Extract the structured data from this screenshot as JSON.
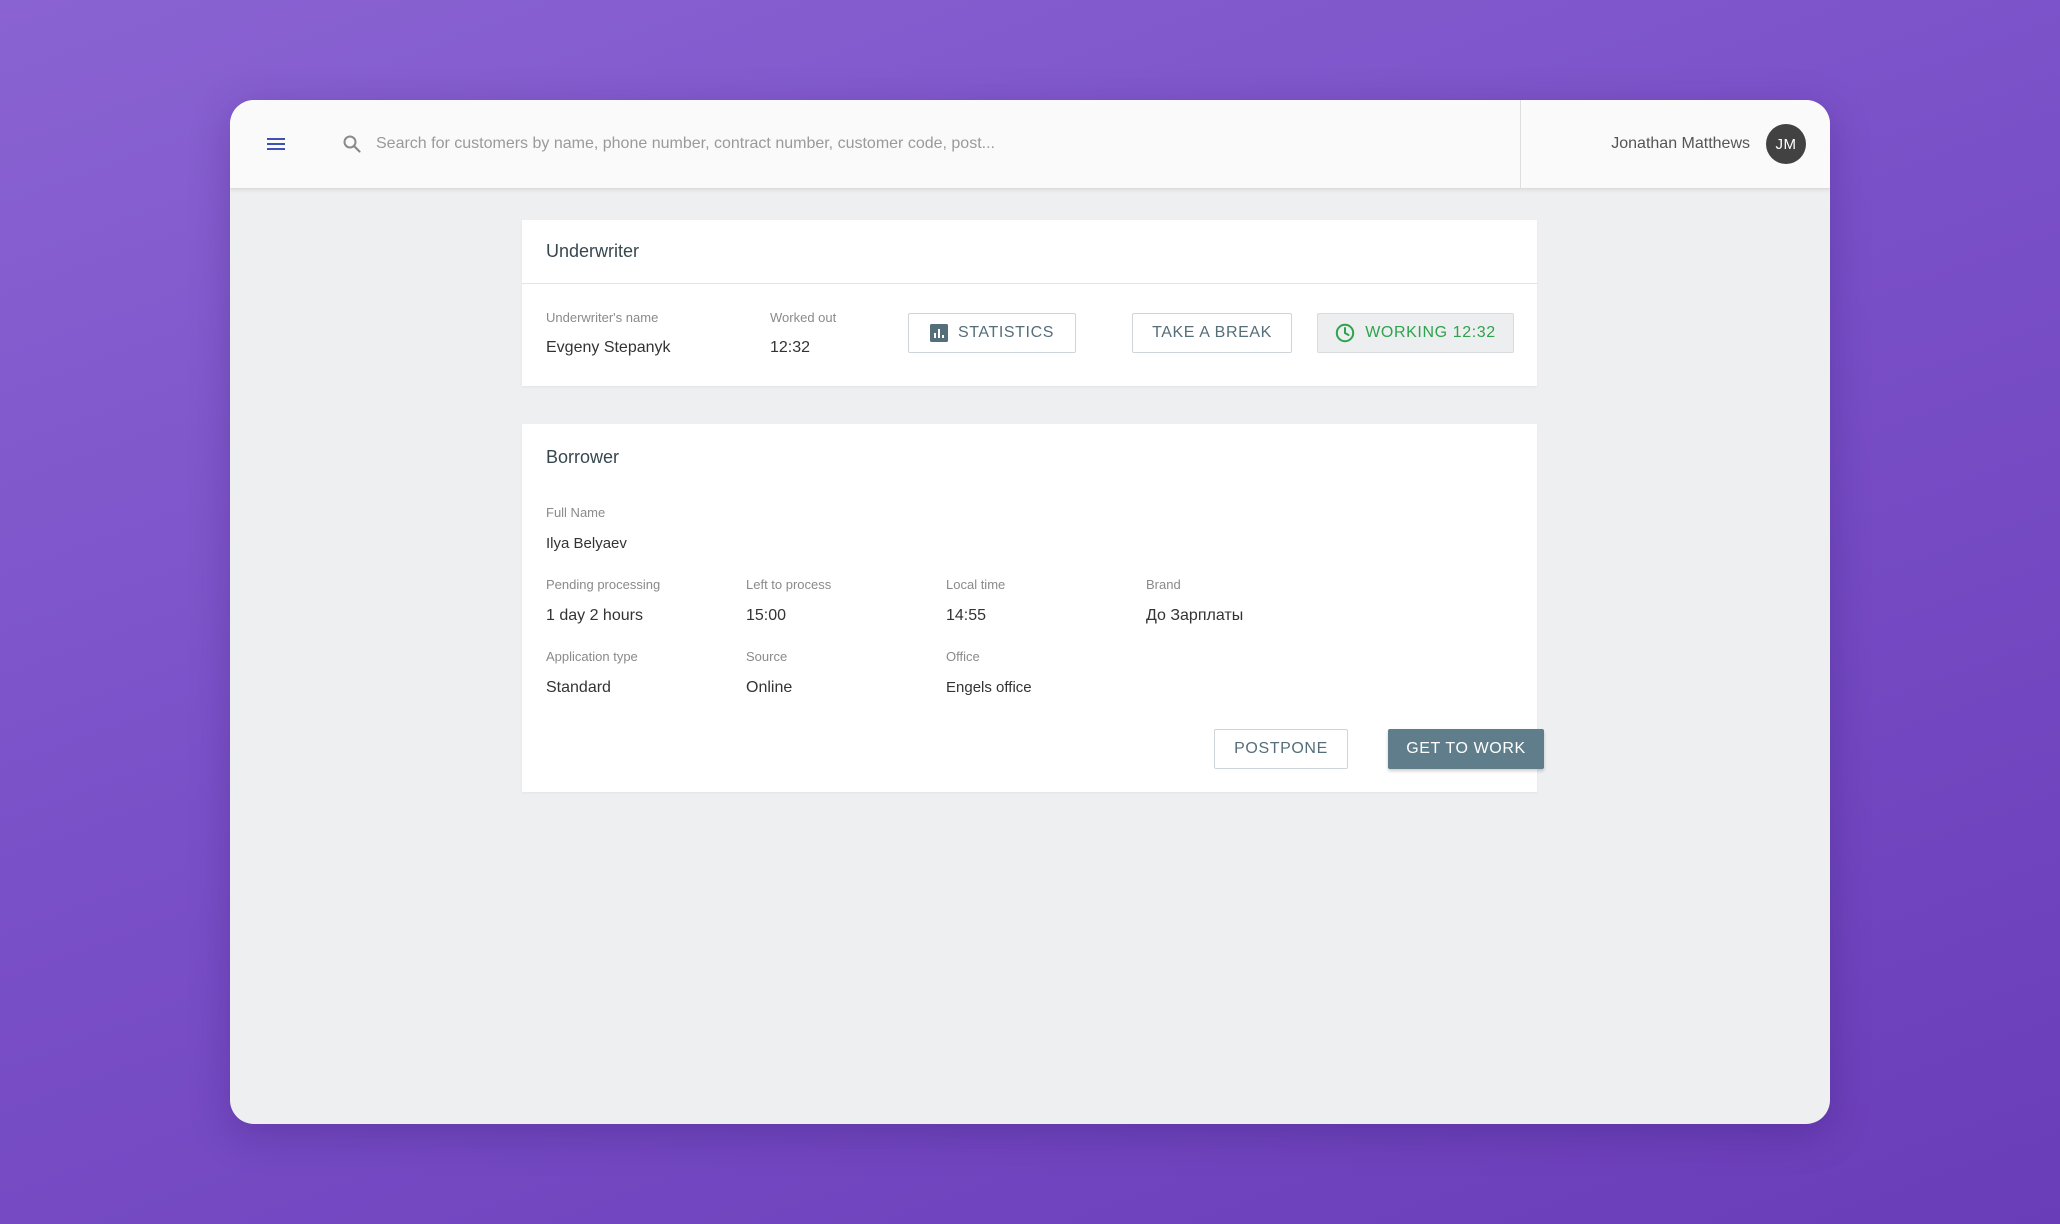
{
  "topbar": {
    "search_placeholder": "Search for customers by name, phone number, contract number, customer code, post...",
    "user_name": "Jonathan Matthews",
    "user_initials": "JM"
  },
  "underwriter": {
    "title": "Underwriter",
    "name_label": "Underwriter's name",
    "name_value": "Evgeny Stepanyk",
    "worked_label": "Worked out",
    "worked_value": "12:32",
    "statistics_label": "STATISTICS",
    "break_label": "TAKE A BREAK",
    "working_label": "WORKING 12:32"
  },
  "borrower": {
    "title": "Borrower",
    "full_name_label": "Full Name",
    "full_name_value": "Ilya Belyaev",
    "pending_label": "Pending processing",
    "pending_value": "1 day 2 hours",
    "left_label": "Left to process",
    "left_value": "15:00",
    "local_time_label": "Local time",
    "local_time_value": "14:55",
    "brand_label": "Brand",
    "brand_value": "До Зарплаты",
    "app_type_label": "Application type",
    "app_type_value": "Standard",
    "source_label": "Source",
    "source_value": "Online",
    "office_label": "Office",
    "office_value": "Engels office",
    "postpone_label": "POSTPONE",
    "get_to_work_label": "GET TO WORK"
  },
  "colors": {
    "background_purple": "#7a50c8",
    "primary_button": "#607d8b",
    "working_green": "#2ea34d",
    "menu_icon_blue": "#3f51b5"
  }
}
